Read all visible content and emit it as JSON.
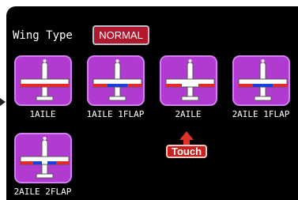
{
  "wing_type": {
    "label": "Wing Type",
    "value": "NORMAL"
  },
  "options": [
    {
      "label": "1AILE",
      "icon": "plane-1aile-icon",
      "colors": [
        "#ffffff",
        "#e22a2a"
      ]
    },
    {
      "label": "1AILE 1FLAP",
      "icon": "plane-1aile-1flap-icon",
      "colors": [
        "#e22a2a",
        "#1a3fd8"
      ]
    },
    {
      "label": "2AILE",
      "icon": "plane-2aile-icon",
      "colors": [
        "#e22a2a",
        "#ffffff"
      ]
    },
    {
      "label": "2AILE 1FLAP",
      "icon": "plane-2aile-1flap-icon",
      "colors": [
        "#e22a2a",
        "#1a3fd8"
      ]
    },
    {
      "label": "2AILE 2FLAP",
      "icon": "plane-2aile-2flap-icon",
      "colors": [
        "#e22a2a",
        "#1a3fd8"
      ]
    }
  ],
  "callout": {
    "label": "Touch",
    "color": "#e1312b"
  }
}
